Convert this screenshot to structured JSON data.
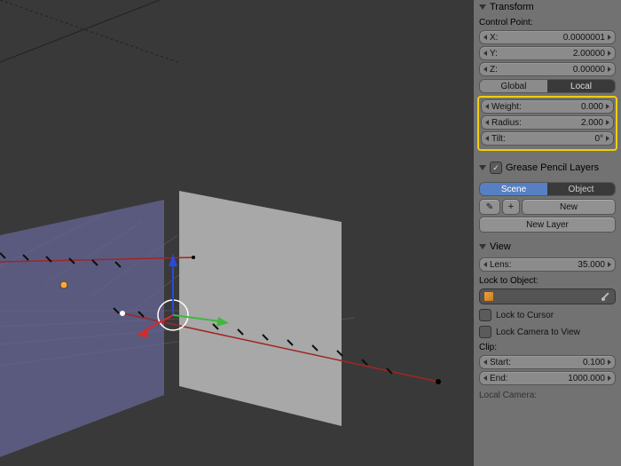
{
  "transform": {
    "title": "Transform",
    "control_point_label": "Control Point:",
    "x_label": "X:",
    "x_value": "0.0000001",
    "y_label": "Y:",
    "y_value": "2.00000",
    "z_label": "Z:",
    "z_value": "0.00000",
    "space_global": "Global",
    "space_local": "Local",
    "weight_label": "Weight:",
    "weight_value": "0.000",
    "radius_label": "Radius:",
    "radius_value": "2.000",
    "tilt_label": "Tilt:",
    "tilt_value": "0°"
  },
  "grease": {
    "title": "Grease Pencil Layers",
    "scene_label": "Scene",
    "object_label": "Object",
    "new_label": "New",
    "new_layer_label": "New Layer"
  },
  "view": {
    "title": "View",
    "lens_label": "Lens:",
    "lens_value": "35.000",
    "lock_to_object_label": "Lock to Object:",
    "lock_to_cursor_label": "Lock to Cursor",
    "lock_camera_label": "Lock Camera to View",
    "clip_label": "Clip:",
    "start_label": "Start:",
    "start_value": "0.100",
    "end_label": "End:",
    "end_value": "1000.000",
    "local_camera_label": "Local Camera:"
  }
}
